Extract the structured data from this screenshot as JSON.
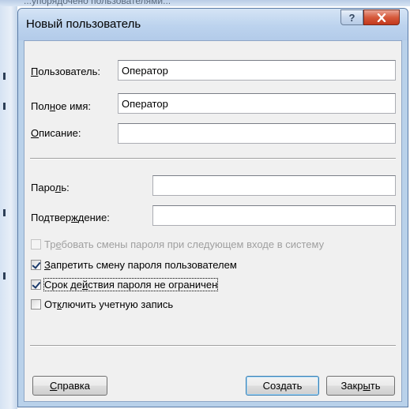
{
  "background": {
    "top_text": "...упорядочено пользователями..."
  },
  "window": {
    "title": "Новый пользователь",
    "help_glyph": "?"
  },
  "form": {
    "username": {
      "label_pre": "",
      "label_acc": "П",
      "label_post": "ользователь:",
      "value": "Оператор"
    },
    "fullname": {
      "label_pre": "Пол",
      "label_acc": "н",
      "label_post": "ое имя:",
      "value": "Оператор"
    },
    "description": {
      "label_pre": "",
      "label_acc": "О",
      "label_post": "писание:",
      "value": ""
    },
    "password": {
      "label_pre": "Паро",
      "label_acc": "л",
      "label_post": "ь:",
      "value": ""
    },
    "confirm": {
      "label_pre": "Подтвер",
      "label_acc": "ж",
      "label_post": "дение:",
      "value": ""
    }
  },
  "checkboxes": [
    {
      "pre": "Тр",
      "acc": "е",
      "post": "бовать смены пароля при следующем входе в систему",
      "checked": false,
      "disabled": true
    },
    {
      "pre": "",
      "acc": "З",
      "post": "апретить смену пароля пользователем",
      "checked": true,
      "disabled": false
    },
    {
      "pre": "Срок де",
      "acc": "й",
      "post": "ствия пароля не ограничен",
      "checked": true,
      "disabled": false
    },
    {
      "pre": "От",
      "acc": "к",
      "post": "лючить учетную запись",
      "checked": false,
      "disabled": false
    }
  ],
  "buttons": {
    "help": {
      "pre": "",
      "acc": "С",
      "post": "правка"
    },
    "create": {
      "pre": "Соз",
      "acc": "д",
      "post": "ать"
    },
    "close": {
      "pre": "Закр",
      "acc": "ы",
      "post": "ть"
    }
  }
}
